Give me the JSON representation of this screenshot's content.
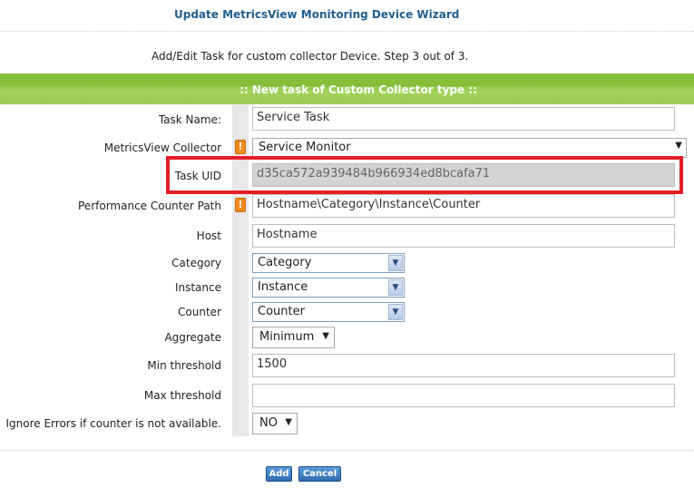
{
  "wizard": {
    "title": "Update MetricsView Monitoring Device Wizard",
    "step_text": "Add/Edit Task for custom collector Device. Step 3 out of 3.",
    "section_title": ":: New task of Custom Collector type ::"
  },
  "form": {
    "task_name": {
      "label": "Task Name:",
      "value": "Service Task"
    },
    "collector": {
      "label": "MetricsView Collector",
      "value": "Service Monitor",
      "required": true
    },
    "task_uid": {
      "label": "Task UID",
      "value": "d35ca572a939484b966934ed8bcafa71"
    },
    "perf_path": {
      "label": "Performance Counter Path",
      "value": "Hostname\\Category\\Instance\\Counter",
      "required": true
    },
    "host": {
      "label": "Host",
      "value": "Hostname"
    },
    "category": {
      "label": "Category",
      "value": "Category"
    },
    "instance": {
      "label": "Instance",
      "value": "Instance"
    },
    "counter": {
      "label": "Counter",
      "value": "Counter"
    },
    "aggregate": {
      "label": "Aggregate",
      "value": "Minimum"
    },
    "min_threshold": {
      "label": "Min threshold",
      "value": "1500"
    },
    "max_threshold": {
      "label": "Max threshold",
      "value": ""
    },
    "ignore_errors": {
      "label": "Ignore Errors if counter is not available.",
      "value": "NO"
    }
  },
  "warning_glyph": "!",
  "buttons": {
    "add": "Add",
    "cancel": "Cancel"
  },
  "colors": {
    "title": "#1f5f8f",
    "header_bar": "#8bc34a",
    "highlight": "#e41e26",
    "button": "#2f6db0"
  }
}
